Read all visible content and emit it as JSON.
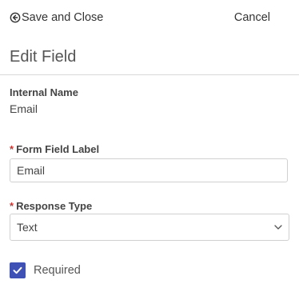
{
  "toolbar": {
    "save_close_label": "Save and Close",
    "save_close_icon": "arrow-circle-left-icon",
    "cancel_label": "Cancel"
  },
  "page": {
    "title": "Edit Field"
  },
  "internal_name": {
    "label": "Internal Name",
    "value": "Email"
  },
  "form_field_label": {
    "required_marker": "*",
    "label": "Form Field Label",
    "value": "Email"
  },
  "response_type": {
    "required_marker": "*",
    "label": "Response Type",
    "selected": "Text",
    "icon": "chevron-down-icon"
  },
  "required_checkbox": {
    "label": "Required",
    "checked": true,
    "color": "#3f51b5"
  },
  "colors": {
    "required_marker": "#c23934",
    "checkbox_accent": "#3f51b5",
    "text": "#333333"
  }
}
